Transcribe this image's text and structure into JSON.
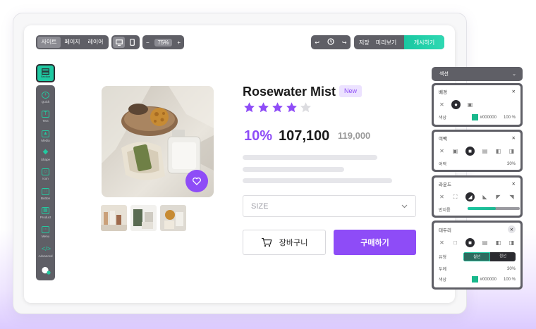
{
  "toolbar": {
    "menu": [
      "사이트",
      "페이지",
      "레이어"
    ],
    "zoom_label": "75%",
    "save_label": "저장",
    "preview_label": "미리보기",
    "publish_label": "게시하기"
  },
  "sidebar": {
    "top_label": "Section",
    "items": [
      {
        "label": "Quick",
        "icon": "plus-icon"
      },
      {
        "label": "Text",
        "icon": "text-icon"
      },
      {
        "label": "Media",
        "icon": "media-icon"
      },
      {
        "label": "Shape",
        "icon": "shape-icon"
      },
      {
        "label": "Icon",
        "icon": "smile-icon"
      },
      {
        "label": "Button",
        "icon": "button-icon"
      },
      {
        "label": "Product",
        "icon": "product-icon"
      },
      {
        "label": "Menu",
        "icon": "menu-icon"
      },
      {
        "label": "Advanced",
        "icon": "code-icon"
      }
    ]
  },
  "product": {
    "title": "Rosewater Mist",
    "badge": "New",
    "rating": 4,
    "rating_max": 5,
    "discount": "10%",
    "price": "107,100",
    "original_price": "119,000",
    "size_placeholder": "SIZE",
    "cart_label": "장바구니",
    "buy_label": "구매하기"
  },
  "panels": {
    "header": "섹션",
    "background": {
      "title": "배경",
      "color_label": "색상",
      "color_value": "#000000",
      "opacity": "100 %"
    },
    "margin": {
      "title": "여백",
      "row_label": "여백",
      "value": "30%"
    },
    "round": {
      "title": "라운드",
      "radius_label": "반지름",
      "radius_level": 0.54
    },
    "border": {
      "title": "테두리",
      "type_label": "유형",
      "types": [
        "실선",
        "점선"
      ],
      "selected_type": "실선",
      "thickness_label": "두께",
      "thickness": "30%",
      "color_label": "색상",
      "color_value": "#000000",
      "opacity": "100 %"
    }
  },
  "colors": {
    "accent": "#8e4cf7",
    "teal": "#1fc9a2",
    "toolbar": "#5f5f66"
  }
}
